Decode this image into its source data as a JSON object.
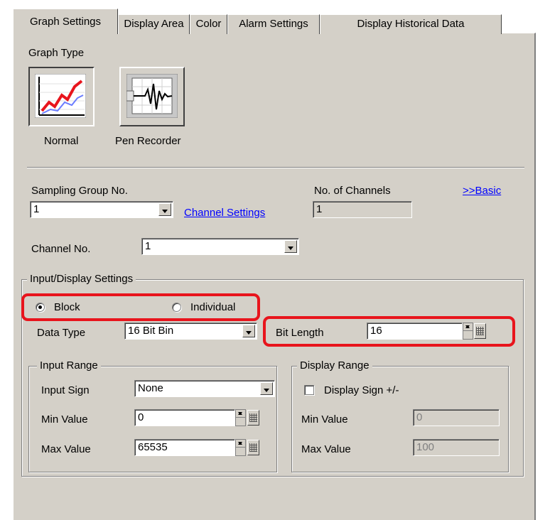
{
  "tabs": [
    {
      "label": "Graph Settings",
      "active": true
    },
    {
      "label": "Display Area",
      "active": false
    },
    {
      "label": "Color",
      "active": false
    },
    {
      "label": "Alarm Settings",
      "active": false
    },
    {
      "label": "Display Historical Data",
      "active": false
    }
  ],
  "graph_type": {
    "label": "Graph Type",
    "options": [
      {
        "label": "Normal",
        "icon": "line-graph-icon",
        "selected": true
      },
      {
        "label": "Pen Recorder",
        "icon": "pen-recorder-icon",
        "selected": false
      }
    ]
  },
  "sampling": {
    "group_label": "Sampling Group No.",
    "group_value": "1",
    "channel_settings_link": "Channel Settings",
    "channels_label": "No. of Channels",
    "channels_value": "1",
    "basic_link": ">>Basic",
    "channel_no_label": "Channel No.",
    "channel_no_value": "1"
  },
  "input_display": {
    "legend": "Input/Display Settings",
    "radio_block": "Block",
    "radio_individual": "Individual",
    "selected_mode": "Block",
    "data_type_label": "Data Type",
    "data_type_value": "16 Bit Bin",
    "bit_length_label": "Bit Length",
    "bit_length_value": "16"
  },
  "input_range": {
    "legend": "Input Range",
    "sign_label": "Input Sign",
    "sign_value": "None",
    "min_label": "Min Value",
    "min_value": "0",
    "max_label": "Max Value",
    "max_value": "65535"
  },
  "display_range": {
    "legend": "Display Range",
    "sign_checkbox_label": "Display Sign +/-",
    "sign_checked": false,
    "min_label": "Min Value",
    "min_value": "0",
    "max_label": "Max Value",
    "max_value": "100"
  },
  "colors": {
    "highlight": "#e8141c",
    "dialog_bg": "#d4d0c8",
    "link": "#0000ff"
  }
}
